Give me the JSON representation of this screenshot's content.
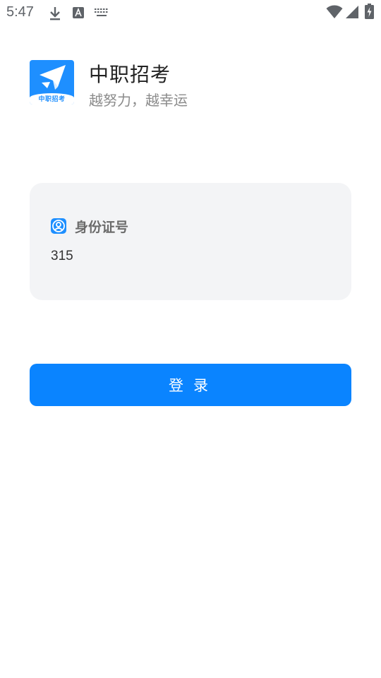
{
  "status_bar": {
    "time": "5:47",
    "icons": [
      "download-icon",
      "font-a-icon",
      "keyboard-icon",
      "wifi-icon",
      "signal-icon",
      "battery-charging-icon"
    ]
  },
  "app": {
    "logo_text": "中职招考",
    "name": "中职招考",
    "slogan": "越努力，越幸运"
  },
  "login_form": {
    "id_label": "身份证号",
    "id_value": "315",
    "login_button": "登录"
  },
  "colors": {
    "brand": "#1e8fff",
    "button": "#0a84ff",
    "card_bg": "#f3f4f6"
  }
}
